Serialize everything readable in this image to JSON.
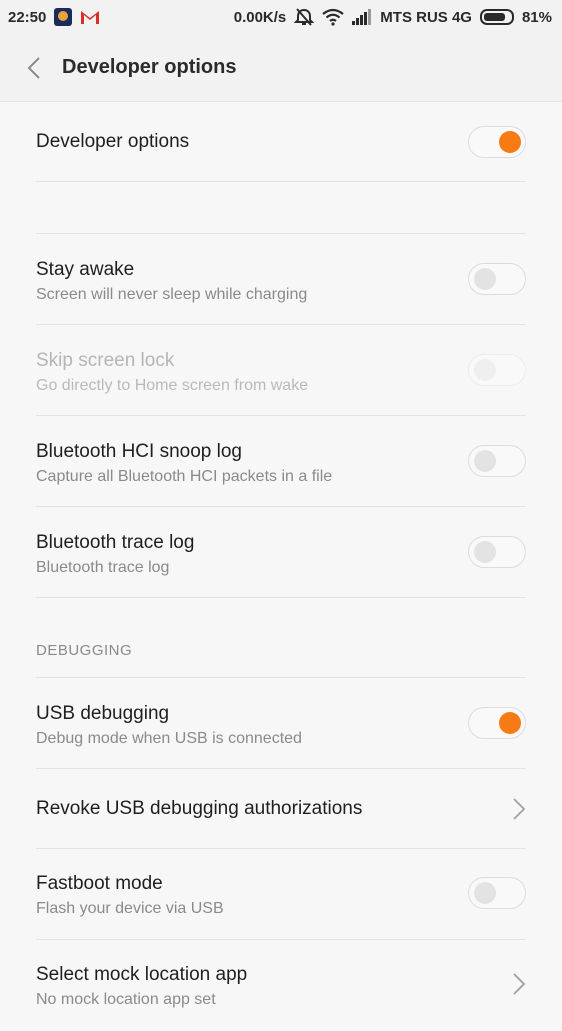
{
  "status_bar": {
    "time": "22:50",
    "speed": "0.00K/s",
    "carrier": "MTS RUS 4G",
    "battery_percent": "81%",
    "battery_level": 0.81
  },
  "header": {
    "title": "Developer options"
  },
  "rows": {
    "developer_options": {
      "title": "Developer options",
      "on": true
    },
    "stay_awake": {
      "title": "Stay awake",
      "subtitle": "Screen will never sleep while charging",
      "on": false
    },
    "skip_screen_lock": {
      "title": "Skip screen lock",
      "subtitle": "Go directly to Home screen from wake",
      "on": false,
      "disabled": true
    },
    "bt_hci_snoop": {
      "title": "Bluetooth HCI snoop log",
      "subtitle": "Capture all Bluetooth HCI packets in a file",
      "on": false
    },
    "bt_trace": {
      "title": "Bluetooth trace log",
      "subtitle": "Bluetooth trace log",
      "on": false
    },
    "usb_debugging": {
      "title": "USB debugging",
      "subtitle": "Debug mode when USB is connected",
      "on": true
    },
    "revoke_usb": {
      "title": "Revoke USB debugging authorizations"
    },
    "fastboot": {
      "title": "Fastboot mode",
      "subtitle": "Flash your device via USB",
      "on": false
    },
    "mock_location": {
      "title": "Select mock location app",
      "subtitle": "No mock location app set"
    }
  },
  "sections": {
    "debugging": "DEBUGGING"
  },
  "colors": {
    "accent": "#f77b14"
  }
}
